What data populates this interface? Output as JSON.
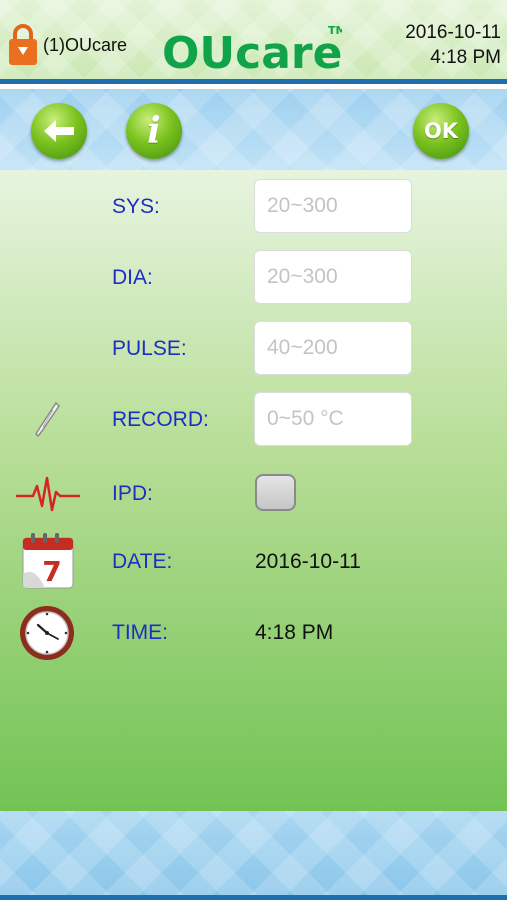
{
  "header": {
    "user_label": "(1)OUcare",
    "logo_text": "OUcare",
    "trademark": "TM",
    "date": "2016-10-11",
    "time": "4:18 PM"
  },
  "toolbar": {
    "back_icon": "arrow-left-icon",
    "info_label": "i",
    "ok_label": "OK"
  },
  "form": {
    "sys": {
      "label": "SYS:",
      "placeholder": "20~300",
      "value": ""
    },
    "dia": {
      "label": "DIA:",
      "placeholder": "20~300",
      "value": ""
    },
    "pulse": {
      "label": "PULSE:",
      "placeholder": "40~200",
      "value": ""
    },
    "record": {
      "label": "RECORD:",
      "placeholder": "0~50 °C",
      "value": "",
      "icon": "thermometer-icon"
    },
    "ipd": {
      "label": "IPD:",
      "checked": false,
      "icon": "heartbeat-icon"
    },
    "date": {
      "label": "DATE:",
      "value": "2016-10-11",
      "icon": "calendar-icon",
      "calendar_day": "7"
    },
    "time": {
      "label": "TIME:",
      "value": "4:18 PM",
      "icon": "clock-icon"
    }
  },
  "colors": {
    "label_blue": "#1d2fc0",
    "button_green": "#7cc31f",
    "header_border": "#1f6fae"
  }
}
